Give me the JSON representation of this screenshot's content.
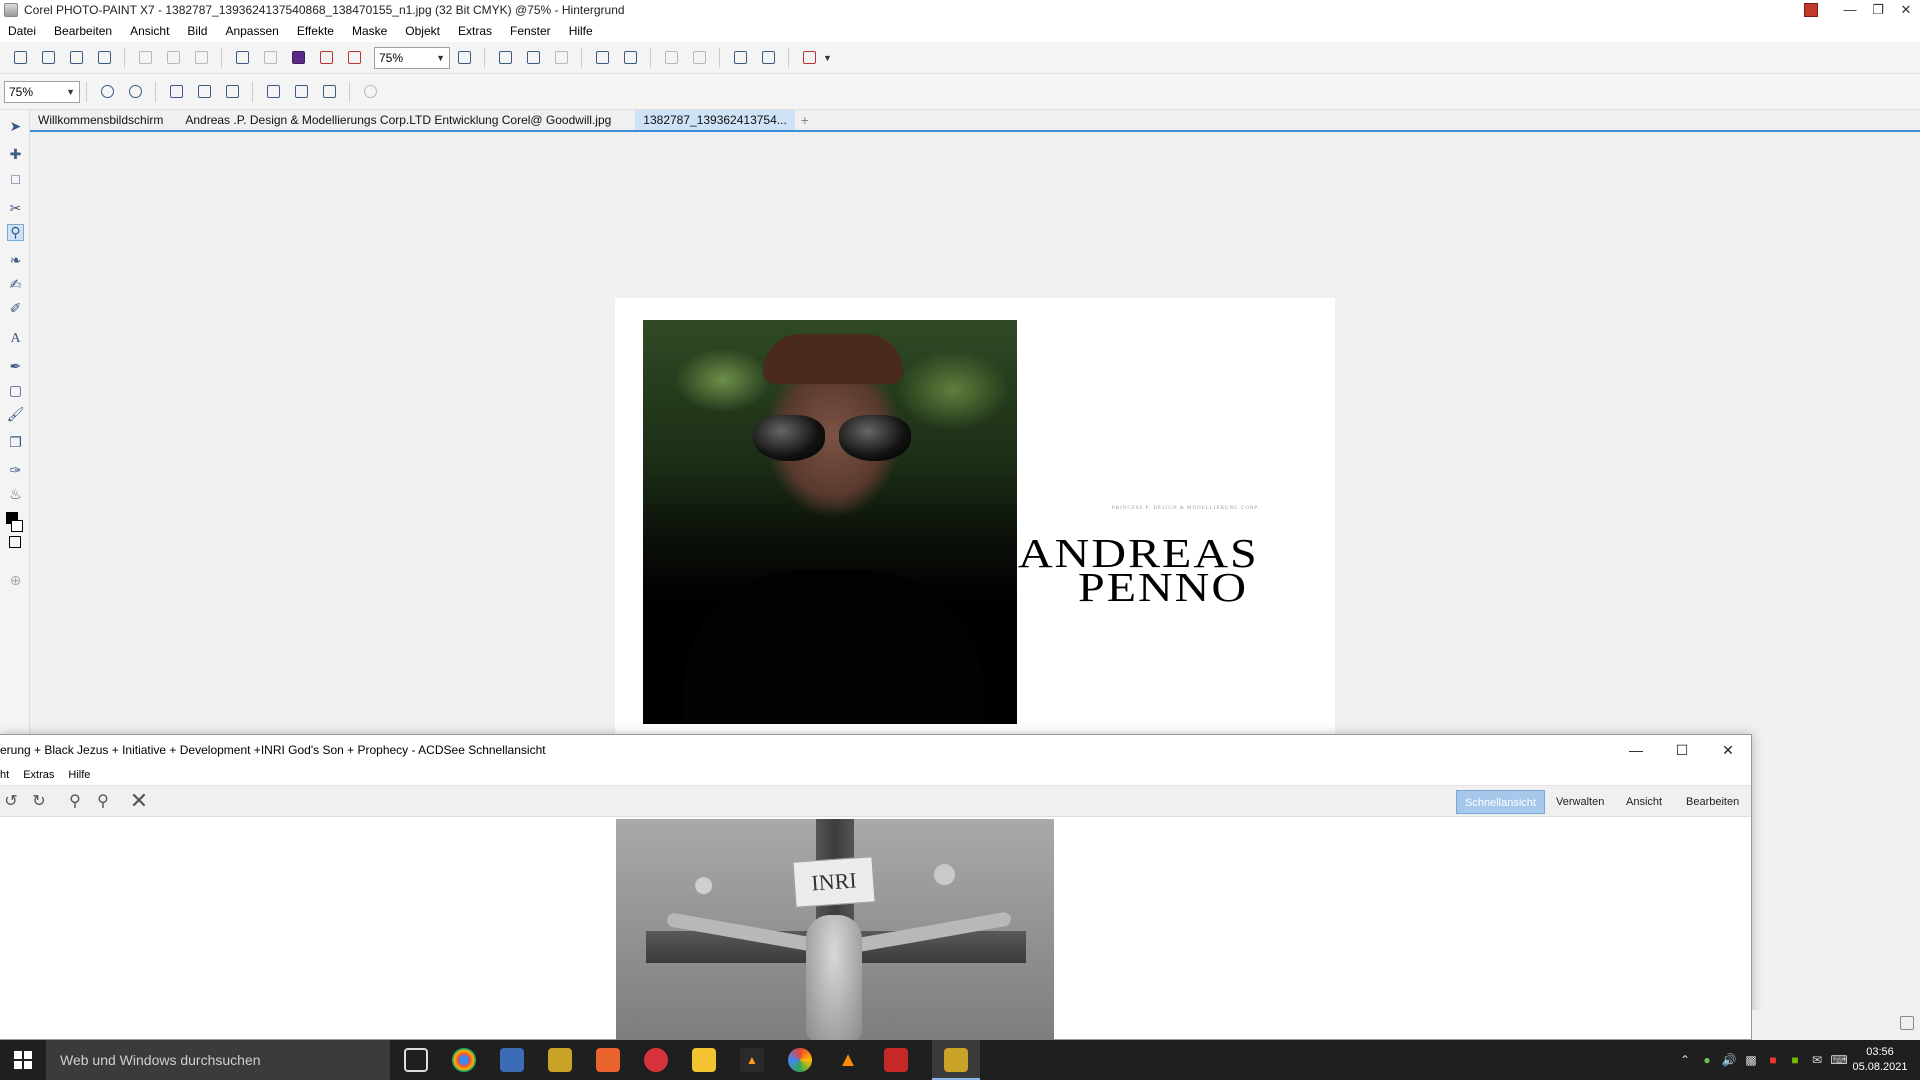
{
  "corel": {
    "title": "Corel PHOTO-PAINT X7 - 1382787_1393624137540868_138470155_n1.jpg (32 Bit CMYK) @75% - Hintergrund",
    "menu": [
      "Datei",
      "Bearbeiten",
      "Ansicht",
      "Bild",
      "Anpassen",
      "Effekte",
      "Maske",
      "Objekt",
      "Extras",
      "Fenster",
      "Hilfe"
    ],
    "zoom_standard": "75%",
    "zoom_toolbar": "75%",
    "tabs": [
      {
        "label": "Willkommensbildschirm"
      },
      {
        "label": "Andreas .P. Design & Modellierungs Corp.LTD Entwicklung Corel@ Goodwill.jpg"
      },
      {
        "label": "1382787_139362413754..."
      }
    ],
    "canvas": {
      "caption_small": "PRINCESS P. DESIGN & MODELLIERUNG CORP.",
      "name_line1": "ANDREAS",
      "name_line2": "PENNO"
    }
  },
  "acdsee": {
    "title": "erung + Black Jezus + Initiative + Development +INRI God's Son + Prophecy - ACDSee Schnellansicht",
    "menu": [
      "ht",
      "Extras",
      "Hilfe"
    ],
    "modes": [
      "Schnellansicht",
      "Verwalten",
      "Ansicht",
      "Bearbeiten"
    ],
    "active_mode": "Schnellansicht",
    "image_sign_text": "INRI"
  },
  "taskbar": {
    "search_placeholder": "Web und Windows durchsuchen",
    "time": "03:56",
    "date": "05.08.2021"
  }
}
